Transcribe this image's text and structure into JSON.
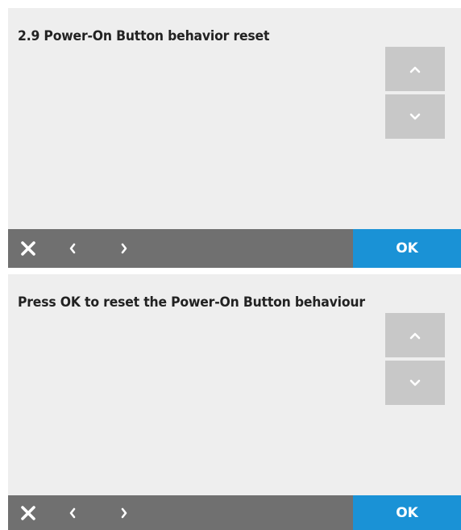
{
  "screens": [
    {
      "title": "2.9 Power-On Button behavior reset",
      "ok_label": "OK",
      "icons": {
        "close": "close-icon",
        "back": "chevron-left-icon",
        "forward": "chevron-right-icon",
        "scroll_up": "chevron-up-icon",
        "scroll_down": "chevron-down-icon"
      }
    },
    {
      "title": "Press OK to reset the Power-On Button behaviour",
      "ok_label": "OK",
      "icons": {
        "close": "close-icon",
        "back": "chevron-left-icon",
        "forward": "chevron-right-icon",
        "scroll_up": "chevron-up-icon",
        "scroll_down": "chevron-down-icon"
      }
    }
  ],
  "colors": {
    "ok_button": "#1a92d6",
    "bottom_bar": "#707070",
    "scroll_button": "#c8c8c8",
    "screen_background": "#eeeeee"
  }
}
